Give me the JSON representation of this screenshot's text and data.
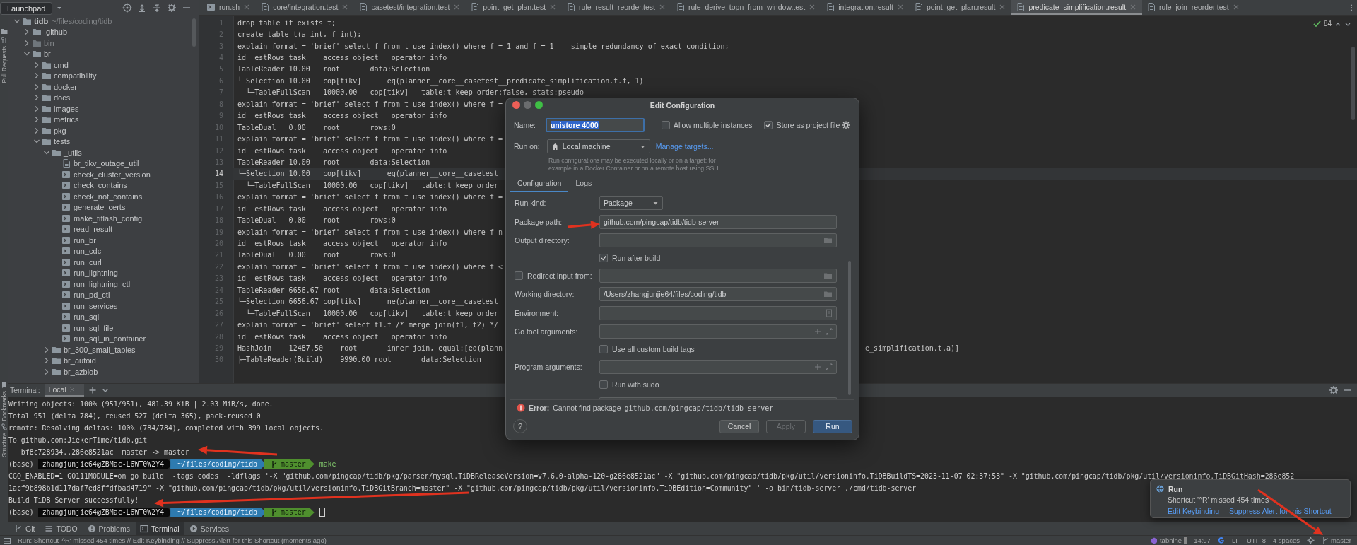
{
  "left_strip": {
    "labels": [
      {
        "label": "Pull Requests",
        "kind": "pull-requests"
      },
      {
        "label": "Bookmarks",
        "kind": "bookmarks"
      },
      {
        "label": "Structure",
        "kind": "structure"
      }
    ]
  },
  "project": {
    "tooltip": "Launchpad",
    "tree": [
      {
        "name": "tidb",
        "path": "~/files/coding/tidb",
        "kind": "folder",
        "expanded": true,
        "children": [
          {
            "name": ".github",
            "kind": "folder",
            "expanded": false
          },
          {
            "name": "bin",
            "kind": "excluded-folder",
            "expanded": false
          },
          {
            "name": "br",
            "kind": "folder",
            "expanded": true,
            "children": [
              {
                "name": "cmd",
                "kind": "folder",
                "expanded": false
              },
              {
                "name": "compatibility",
                "kind": "folder",
                "expanded": false
              },
              {
                "name": "docker",
                "kind": "folder",
                "expanded": false
              },
              {
                "name": "docs",
                "kind": "folder",
                "expanded": false
              },
              {
                "name": "images",
                "kind": "folder",
                "expanded": false
              },
              {
                "name": "metrics",
                "kind": "folder",
                "expanded": false
              },
              {
                "name": "pkg",
                "kind": "folder",
                "expanded": false
              },
              {
                "name": "tests",
                "kind": "folder",
                "expanded": true,
                "children": [
                  {
                    "name": "_utils",
                    "kind": "folder",
                    "expanded": true,
                    "children": [
                      {
                        "name": "br_tikv_outage_util",
                        "kind": "file"
                      },
                      {
                        "name": "check_cluster_version",
                        "kind": "script"
                      },
                      {
                        "name": "check_contains",
                        "kind": "script"
                      },
                      {
                        "name": "check_not_contains",
                        "kind": "script"
                      },
                      {
                        "name": "generate_certs",
                        "kind": "script"
                      },
                      {
                        "name": "make_tiflash_config",
                        "kind": "script"
                      },
                      {
                        "name": "read_result",
                        "kind": "script"
                      },
                      {
                        "name": "run_br",
                        "kind": "script"
                      },
                      {
                        "name": "run_cdc",
                        "kind": "script"
                      },
                      {
                        "name": "run_curl",
                        "kind": "script"
                      },
                      {
                        "name": "run_lightning",
                        "kind": "script"
                      },
                      {
                        "name": "run_lightning_ctl",
                        "kind": "script"
                      },
                      {
                        "name": "run_pd_ctl",
                        "kind": "script"
                      },
                      {
                        "name": "run_services",
                        "kind": "script"
                      },
                      {
                        "name": "run_sql",
                        "kind": "script"
                      },
                      {
                        "name": "run_sql_file",
                        "kind": "script"
                      },
                      {
                        "name": "run_sql_in_container",
                        "kind": "script"
                      }
                    ]
                  },
                  {
                    "name": "br_300_small_tables",
                    "kind": "folder",
                    "expanded": false
                  },
                  {
                    "name": "br_autoid",
                    "kind": "folder",
                    "expanded": false
                  },
                  {
                    "name": "br_azblob",
                    "kind": "folder",
                    "expanded": false
                  }
                ]
              }
            ]
          }
        ]
      }
    ]
  },
  "tabs": [
    {
      "label": "run.sh",
      "kind": "script",
      "selected": false
    },
    {
      "label": "core/integration.test",
      "kind": "file",
      "selected": false
    },
    {
      "label": "casetest/integration.test",
      "kind": "file",
      "selected": false
    },
    {
      "label": "point_get_plan.test",
      "kind": "file",
      "selected": false
    },
    {
      "label": "rule_result_reorder.test",
      "kind": "file",
      "selected": false
    },
    {
      "label": "rule_derive_topn_from_window.test",
      "kind": "file",
      "selected": false
    },
    {
      "label": "integration.result",
      "kind": "file",
      "selected": false
    },
    {
      "label": "point_get_plan.result",
      "kind": "file",
      "selected": false
    },
    {
      "label": "predicate_simplification.result",
      "kind": "file",
      "selected": true
    },
    {
      "label": "rule_join_reorder.test",
      "kind": "file",
      "selected": false
    }
  ],
  "editor": {
    "inspection_count": "84",
    "lines": [
      {
        "number": "1",
        "text": "drop table if exists t;",
        "current": false
      },
      {
        "number": "2",
        "text": "create table t(a int, f int);",
        "current": false
      },
      {
        "number": "3",
        "text": "explain format = 'brief' select f from t use index() where f = 1 and f = 1 -- simple redundancy of exact condition;",
        "current": false
      },
      {
        "number": "4",
        "text": "id  estRows task    access object   operator info",
        "current": false
      },
      {
        "number": "5",
        "text": "TableReader 10.00   root       data:Selection",
        "current": false
      },
      {
        "number": "6",
        "text": "└─Selection 10.00   cop[tikv]      eq(planner__core__casetest__predicate_simplification.t.f, 1)",
        "current": false
      },
      {
        "number": "7",
        "text": "  └─TableFullScan   10000.00   cop[tikv]   table:t keep order:false, stats:pseudo",
        "current": false
      },
      {
        "number": "8",
        "text": "explain format = 'brief' select f from t use index() where f =",
        "current": false
      },
      {
        "number": "9",
        "text": "id  estRows task    access object   operator info",
        "current": false
      },
      {
        "number": "10",
        "text": "TableDual   0.00    root       rows:0",
        "current": false
      },
      {
        "number": "11",
        "text": "explain format = 'brief' select f from t use index() where f =",
        "current": false
      },
      {
        "number": "12",
        "text": "id  estRows task    access object   operator info",
        "current": false
      },
      {
        "number": "13",
        "text": "TableReader 10.00   root       data:Selection",
        "current": false
      },
      {
        "number": "14",
        "text": "└─Selection 10.00   cop[tikv]      eq(planner__core__casetest",
        "current": true
      },
      {
        "number": "15",
        "text": "  └─TableFullScan   10000.00   cop[tikv]   table:t keep order",
        "current": false
      },
      {
        "number": "16",
        "text": "explain format = 'brief' select f from t use index() where f =",
        "current": false
      },
      {
        "number": "17",
        "text": "id  estRows task    access object   operator info",
        "current": false
      },
      {
        "number": "18",
        "text": "TableDual   0.00    root       rows:0",
        "current": false
      },
      {
        "number": "19",
        "text": "explain format = 'brief' select f from t use index() where f n",
        "current": false
      },
      {
        "number": "20",
        "text": "id  estRows task    access object   operator info",
        "current": false
      },
      {
        "number": "21",
        "text": "TableDual   0.00    root       rows:0",
        "current": false
      },
      {
        "number": "22",
        "text": "explain format = 'brief' select f from t use index() where f <",
        "current": false
      },
      {
        "number": "23",
        "text": "id  estRows task    access object   operator info",
        "current": false
      },
      {
        "number": "24",
        "text": "TableReader 6656.67 root       data:Selection",
        "current": false
      },
      {
        "number": "25",
        "text": "└─Selection 6656.67 cop[tikv]      ne(planner__core__casetest",
        "current": false
      },
      {
        "number": "26",
        "text": "  └─TableFullScan   10000.00   cop[tikv]   table:t keep order",
        "current": false
      },
      {
        "number": "27",
        "text": "explain format = 'brief' select t1.f /* merge_join(t1, t2) */",
        "current": false
      },
      {
        "number": "28",
        "text": "id  estRows task    access object   operator info",
        "current": false
      },
      {
        "number": "29",
        "text": "HashJoin    12487.50    root       inner join, equal:[eq(plann",
        "tail": "e_simplification.t.a)]",
        "current": false
      },
      {
        "number": "30",
        "text": "├─TableReader(Build)    9990.00 root       data:Selection",
        "current": false
      }
    ]
  },
  "dialog": {
    "title": "Edit Configuration",
    "name": {
      "label": "Name:",
      "value": "unistore 4000"
    },
    "options": [
      {
        "label": "Allow multiple instances",
        "checked": false
      },
      {
        "label": "Store as project file",
        "checked": true
      }
    ],
    "run_on": {
      "label": "Run on:",
      "value": "Local machine",
      "link": "Manage targets..."
    },
    "hint": "Run configurations may be executed locally or on a target: for example in a Docker Container or on a remote host using SSH.",
    "tabs": [
      {
        "label": "Configuration",
        "selected": true
      },
      {
        "label": "Logs",
        "selected": false
      }
    ],
    "rows": [
      {
        "kind": "dropdown",
        "label": "Run kind:",
        "value": "Package"
      },
      {
        "kind": "field",
        "label": "Package path:",
        "value": "github.com/pingcap/tidb/tidb-server"
      },
      {
        "kind": "browse",
        "label": "Output directory:"
      },
      {
        "kind": "checkbox",
        "label": "Run after build",
        "checked": true
      },
      {
        "kind": "checkbox-field",
        "label": "Redirect input from:",
        "checked": false
      },
      {
        "kind": "browse",
        "label": "Working directory:",
        "value": "/Users/zhangjunjie64/files/coding/tidb"
      },
      {
        "kind": "env",
        "label": "Environment:"
      },
      {
        "kind": "args",
        "label": "Go tool arguments:"
      },
      {
        "kind": "checkbox",
        "label": "Use all custom build tags",
        "checked": false
      },
      {
        "kind": "args",
        "label": "Program arguments:"
      },
      {
        "kind": "checkbox",
        "label": "Run with sudo",
        "checked": false
      },
      {
        "kind": "partial"
      }
    ],
    "error": {
      "label": "Error:",
      "message": "Cannot find package",
      "package": "github.com/pingcap/tidb/tidb-server"
    },
    "help": "?",
    "buttons": [
      {
        "label": "Cancel",
        "kind": "normal"
      },
      {
        "label": "Apply",
        "kind": "disabled"
      },
      {
        "label": "Run",
        "kind": "default"
      }
    ]
  },
  "terminal": {
    "title": "Terminal:",
    "tabs": [
      {
        "label": "Local",
        "selected": true
      }
    ],
    "lines": [
      {
        "kind": "output",
        "text": "Writing objects: 100% (951/951), 481.39 KiB | 2.03 MiB/s, done."
      },
      {
        "kind": "output",
        "text": "Total 951 (delta 784), reused 527 (delta 365), pack-reused 0"
      },
      {
        "kind": "output",
        "text": "remote: Resolving deltas: 100% (784/784), completed with 399 local objects."
      },
      {
        "kind": "output",
        "text": "To github.com:JiekerTime/tidb.git"
      },
      {
        "kind": "output",
        "text": "   bf8c728934..286e8521ac  master -> master"
      },
      {
        "kind": "prompt",
        "env": "(base)",
        "user": "zhangjunjie64@ZBMac-L6WT0W2Y4",
        "path": "~/files/coding/tidb",
        "branch": "master",
        "command": "make",
        "cursor": false
      },
      {
        "kind": "output",
        "text": "CGO_ENABLED=1 GO111MODULE=on go build  -tags codes  -ldflags '-X \"github.com/pingcap/tidb/pkg/parser/mysql.TiDBReleaseVersion=v7.6.0-alpha-120-g286e8521ac\" -X \"github.com/pingcap/tidb/pkg/util/versioninfo.TiDBBuildTS=2023-11-07 02:37:53\" -X \"github.com/pingcap/tidb/pkg/util/versioninfo.TiDBGitHash=286e852"
      },
      {
        "kind": "output",
        "text": "1acf9b898b1d117daf7ed8ffdfbad4719\" -X \"github.com/pingcap/tidb/pkg/util/versioninfo.TiDBGitBranch=master\" -X \"github.com/pingcap/tidb/pkg/util/versioninfo.TiDBEdition=Community\" ' -o bin/tidb-server ./cmd/tidb-server"
      },
      {
        "kind": "output",
        "text": "Build TiDB Server successfully!"
      },
      {
        "kind": "prompt",
        "env": "(base)",
        "user": "zhangjunjie64@ZBMac-L6WT0W2Y4",
        "path": "~/files/coding/tidb",
        "branch": "master",
        "cursor": true
      }
    ]
  },
  "tool_windows": [
    {
      "label": "Git",
      "kind": "git",
      "selected": false
    },
    {
      "label": "TODO",
      "kind": "todo",
      "selected": false
    },
    {
      "label": "Problems",
      "kind": "problems",
      "selected": false
    },
    {
      "label": "Terminal",
      "kind": "terminal",
      "selected": true
    },
    {
      "label": "Services",
      "kind": "services",
      "selected": false
    }
  ],
  "notification": {
    "title": "Run",
    "message": "Shortcut '^R' missed 454 times",
    "links": [
      "Edit Keybinding",
      "Suppress Alert for this Shortcut"
    ]
  },
  "status_bar": {
    "message": "Run: Shortcut '^R' missed 454 times // Edit Keybinding // Suppress Alert for this Shortcut (moments ago)",
    "items": [
      {
        "kind": "tabnine",
        "text": "tabnine"
      },
      {
        "kind": "text",
        "text": "14:97"
      },
      {
        "kind": "google"
      },
      {
        "kind": "text",
        "text": "LF"
      },
      {
        "kind": "text",
        "text": "UTF-8"
      },
      {
        "kind": "text",
        "text": "4 spaces"
      },
      {
        "kind": "settings"
      },
      {
        "kind": "branch",
        "text": "master"
      }
    ]
  }
}
